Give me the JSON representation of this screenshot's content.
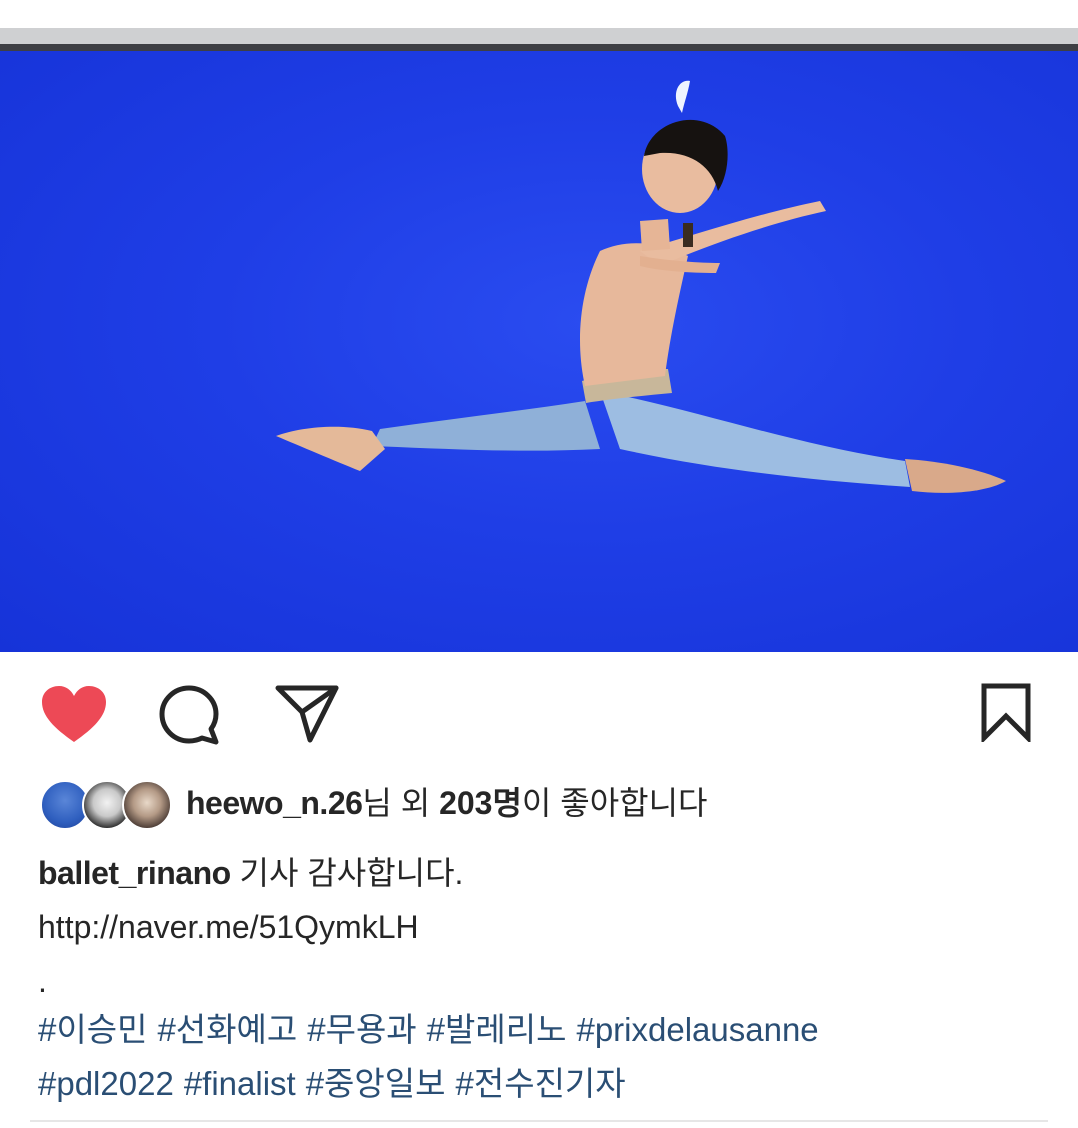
{
  "post": {
    "image_alt": "",
    "accent_heart": "#ed4956",
    "hashtag_color": "#2a4e74",
    "image_background": "#1f3ee6"
  },
  "actions": {
    "like_icon": "heart-filled-icon",
    "comment_icon": "comment-bubble-icon",
    "share_icon": "paper-plane-icon",
    "save_icon": "bookmark-icon"
  },
  "likes": {
    "user": "heewo_n.26",
    "suffix_1": "님 외 ",
    "count": "203명",
    "suffix_2": "이 좋아합니다"
  },
  "caption": {
    "author": "ballet_rinano",
    "text": "기사 감사합니다.",
    "link": "http://naver.me/51QymkLH",
    "separator": "."
  },
  "hashtags": [
    "#이승민",
    "#선화예고",
    "#무용과",
    "#발레리노",
    "#prixdelausanne",
    "#pdl2022",
    "#finalist",
    "#중앙일보",
    "#전수진기자"
  ]
}
